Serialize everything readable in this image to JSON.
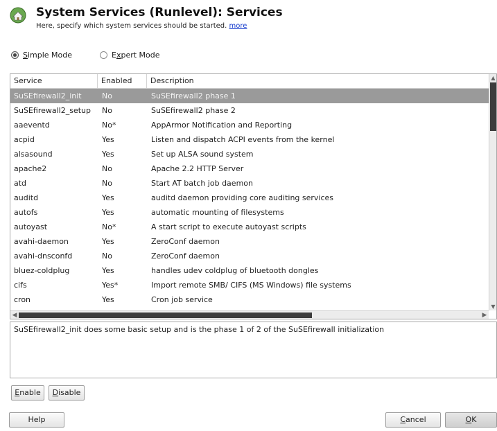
{
  "header": {
    "title": "System Services (Runlevel): Services",
    "subtitle": "Here, specify which system services should be started.",
    "more_link": "more"
  },
  "modes": {
    "simple_prefix": "",
    "simple_accel": "S",
    "simple_rest": "imple Mode",
    "simple_selected": true,
    "expert_prefix": "E",
    "expert_accel": "x",
    "expert_rest": "pert Mode"
  },
  "table": {
    "headers": [
      "Service",
      "Enabled",
      "Description"
    ],
    "selected_index": 0,
    "rows": [
      {
        "service": "SuSEfirewall2_init",
        "enabled": "No",
        "description": "SuSEfirewall2 phase 1"
      },
      {
        "service": "SuSEfirewall2_setup",
        "enabled": "No",
        "description": "SuSEfirewall2 phase 2"
      },
      {
        "service": "aaeventd",
        "enabled": "No*",
        "description": "AppArmor Notification and Reporting"
      },
      {
        "service": "acpid",
        "enabled": "Yes",
        "description": "Listen and dispatch ACPI events from the kernel"
      },
      {
        "service": "alsasound",
        "enabled": "Yes",
        "description": "Set up ALSA sound system"
      },
      {
        "service": "apache2",
        "enabled": "No",
        "description": "Apache 2.2 HTTP Server"
      },
      {
        "service": "atd",
        "enabled": "No",
        "description": "Start AT batch job daemon"
      },
      {
        "service": "auditd",
        "enabled": "Yes",
        "description": "auditd daemon providing core auditing services"
      },
      {
        "service": "autofs",
        "enabled": "Yes",
        "description": "automatic mounting of filesystems"
      },
      {
        "service": "autoyast",
        "enabled": "No*",
        "description": "A start script to execute autoyast scripts"
      },
      {
        "service": "avahi-daemon",
        "enabled": "Yes",
        "description": "ZeroConf daemon"
      },
      {
        "service": "avahi-dnsconfd",
        "enabled": "No",
        "description": "ZeroConf daemon"
      },
      {
        "service": "bluez-coldplug",
        "enabled": "Yes",
        "description": "handles udev coldplug of bluetooth dongles"
      },
      {
        "service": "cifs",
        "enabled": "Yes*",
        "description": "Import remote SMB/ CIFS (MS Windows) file systems"
      },
      {
        "service": "cron",
        "enabled": "Yes",
        "description": "Cron job service"
      }
    ]
  },
  "detail_text": "SuSEfirewall2_init does some basic setup and is the phase 1 of 2 of the SuSEfirewall initialization",
  "buttons": {
    "enable_accel": "E",
    "enable_rest": "nable",
    "disable_accel": "D",
    "disable_rest": "isable",
    "help": "Help",
    "cancel_accel": "C",
    "cancel_rest": "ancel",
    "ok_accel": "O",
    "ok_rest": "K"
  },
  "colors": {
    "selected_row_bg": "#9a9a9a",
    "link": "#1a3fcf",
    "scroll_thumb": "#3c3c3c"
  },
  "icons": {
    "logo": "yast-runlevel-icon",
    "scroll_up": "chevron-up-icon",
    "scroll_down": "chevron-down-icon",
    "scroll_left": "chevron-left-icon",
    "scroll_right": "chevron-right-icon"
  }
}
